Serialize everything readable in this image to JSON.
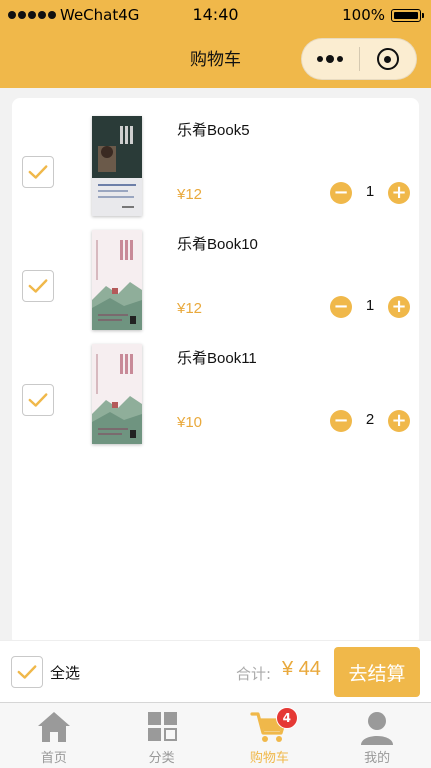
{
  "status_bar": {
    "carrier": "WeChat4G",
    "time": "14:40",
    "battery": "100%"
  },
  "nav": {
    "title": "购物车"
  },
  "items": [
    {
      "name": "乐肴Book5",
      "price": "¥12",
      "quantity": "1",
      "checked": true
    },
    {
      "name": "乐肴Book10",
      "price": "¥12",
      "quantity": "1",
      "checked": true
    },
    {
      "name": "乐肴Book11",
      "price": "¥10",
      "quantity": "2",
      "checked": true
    }
  ],
  "footer": {
    "select_all": "全选",
    "total_label": "合计:",
    "total_value": "¥ 44",
    "checkout": "去结算"
  },
  "tabbar": [
    {
      "label": "首页",
      "icon": "home-icon"
    },
    {
      "label": "分类",
      "icon": "category-icon"
    },
    {
      "label": "购物车",
      "icon": "cart-icon",
      "badge": "4",
      "active": true
    },
    {
      "label": "我的",
      "icon": "user-icon"
    }
  ],
  "colors": {
    "accent": "#f0b84a",
    "price": "#e9a93c",
    "badge": "#e53935"
  }
}
